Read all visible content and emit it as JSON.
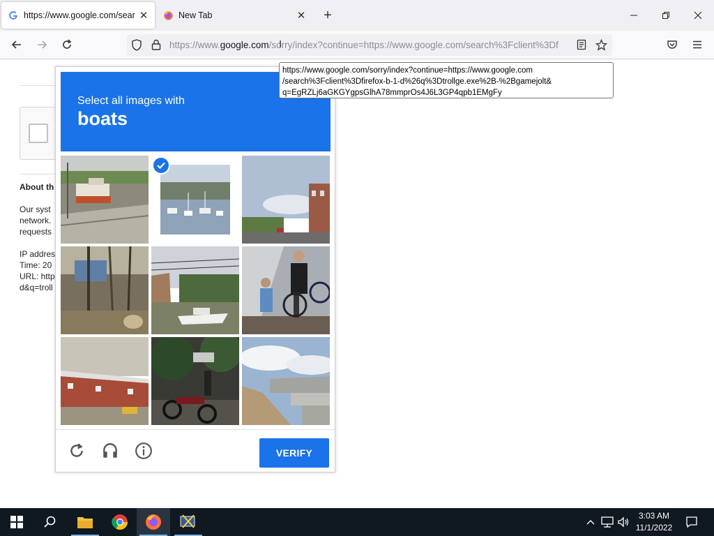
{
  "browser": {
    "tabs": [
      {
        "title": "https://www.google.com/search",
        "active": true,
        "favicon": "google-icon"
      },
      {
        "title": "New Tab",
        "active": false,
        "favicon": "firefox-icon"
      }
    ],
    "url": {
      "prefix": "https://www.",
      "domain": "google.com",
      "rest": "/sorry/index?continue=https://www.google.com/search%3Fclient%3Df"
    },
    "tooltip": {
      "lines": [
        "https://www.google.com/sorry/index?continue=https://www.google.com",
        "/search%3Fclient%3Dfirefox-b-1-d%26q%3Dtrollge.exe%2B-%2Bgamejolt&",
        "q=EgRZLj6aGKGYgpsGlhA78mmprOs4J6L3GP4qpb1EMgFy"
      ]
    }
  },
  "background_page": {
    "about_heading": "About th",
    "body_lines": [
      "Our syst",
      "network.",
      "requests"
    ],
    "meta_lines": [
      "IP addres",
      "Time: 20",
      "URL: http",
      "d&q=troll"
    ]
  },
  "captcha": {
    "instruction": "Select all images with",
    "object": "boats",
    "verify_label": "VERIFY",
    "tiles": [
      {
        "scene": "boat-at-dock",
        "selected": false
      },
      {
        "scene": "harbor-boats",
        "selected": true
      },
      {
        "scene": "street-buildings",
        "selected": false
      },
      {
        "scene": "woods-truck",
        "selected": false
      },
      {
        "scene": "boat-in-yard",
        "selected": false
      },
      {
        "scene": "person-with-bicycle",
        "selected": false
      },
      {
        "scene": "building-car",
        "selected": false
      },
      {
        "scene": "motorcycles-street",
        "selected": false
      },
      {
        "scene": "bridge-sky",
        "selected": false
      }
    ],
    "accent_color": "#1a73e8"
  },
  "taskbar": {
    "time": "3:03 AM",
    "date": "11/1/2022",
    "apps": [
      "file-explorer-icon",
      "chrome-icon",
      "firefox-icon",
      "network-tool-icon"
    ]
  }
}
